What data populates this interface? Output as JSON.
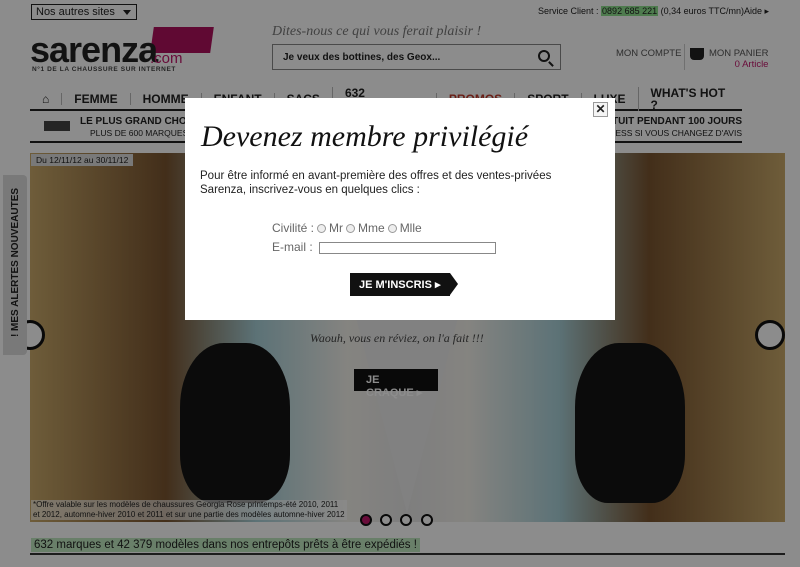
{
  "header": {
    "sites_select": "Nos autres sites",
    "service_label": "Service Client :",
    "service_phone": "0892 685 221",
    "service_rate": "(0,34 euros TTC/mn)",
    "help": "Aide ▸",
    "logo": {
      "word": "sarenza",
      "suffix": ".com",
      "tagline": "N°1 DE LA CHAUSSURE SUR INTERNET"
    },
    "ask": "Dites-nous ce qui vous ferait plaisir !",
    "search_placeholder": "Je veux des bottines, des Geox...",
    "account": "MON COMPTE",
    "cart": "MON PANIER",
    "cart_count": "0 Article"
  },
  "nav": {
    "items": [
      "FEMME",
      "HOMME",
      "ENFANT",
      "SACS",
      "632 MARQUES",
      "PROMOS",
      "SPORT",
      "LUXE",
      "WHAT'S HOT ?"
    ]
  },
  "strip": {
    "left_title": "LE PLUS GRAND CHOIX",
    "left_sub": "PLUS DE 600 MARQUES",
    "right_title": "GRATUIT PENDANT 100 JOURS",
    "right_sub": "STRESS SI VOUS CHANGEZ D'AVIS"
  },
  "hero": {
    "date": "Du 12/11/12 au 30/11/12",
    "slogan": "Waouh, vous en réviez, on l'a fait !!!",
    "cta": "JE CRAQUE ▸",
    "offer_line1": "*Offre valable sur les modèles de chaussures Georgia Rose printemps-été 2010, 2011",
    "offer_line2": "et 2012, automne-hiver 2010 et 2011 et sur une partie des modèles automne-hiver 2012",
    "active_slide": 1,
    "slide_count": 4
  },
  "side_tab": "! MES ALERTES NOUVEAUTES",
  "bottom_text": "632 marques et 42 379 modèles dans nos entrepôts prêts à être expédiés !",
  "modal": {
    "close": "✕",
    "title": "Devenez membre privilégié",
    "text": "Pour être informé en avant-première des offres et des ventes-privées Sarenza, inscrivez-vous en quelques clics :",
    "civility_label": "Civilité :",
    "options": [
      "Mr",
      "Mme",
      "Mlle"
    ],
    "email_label": "E-mail :",
    "email_value": "",
    "submit": "JE M'INSCRIS ▸"
  },
  "colors": {
    "brand": "#b0125e",
    "promo": "#c0392b",
    "phone_highlight": "#8fe08f"
  }
}
